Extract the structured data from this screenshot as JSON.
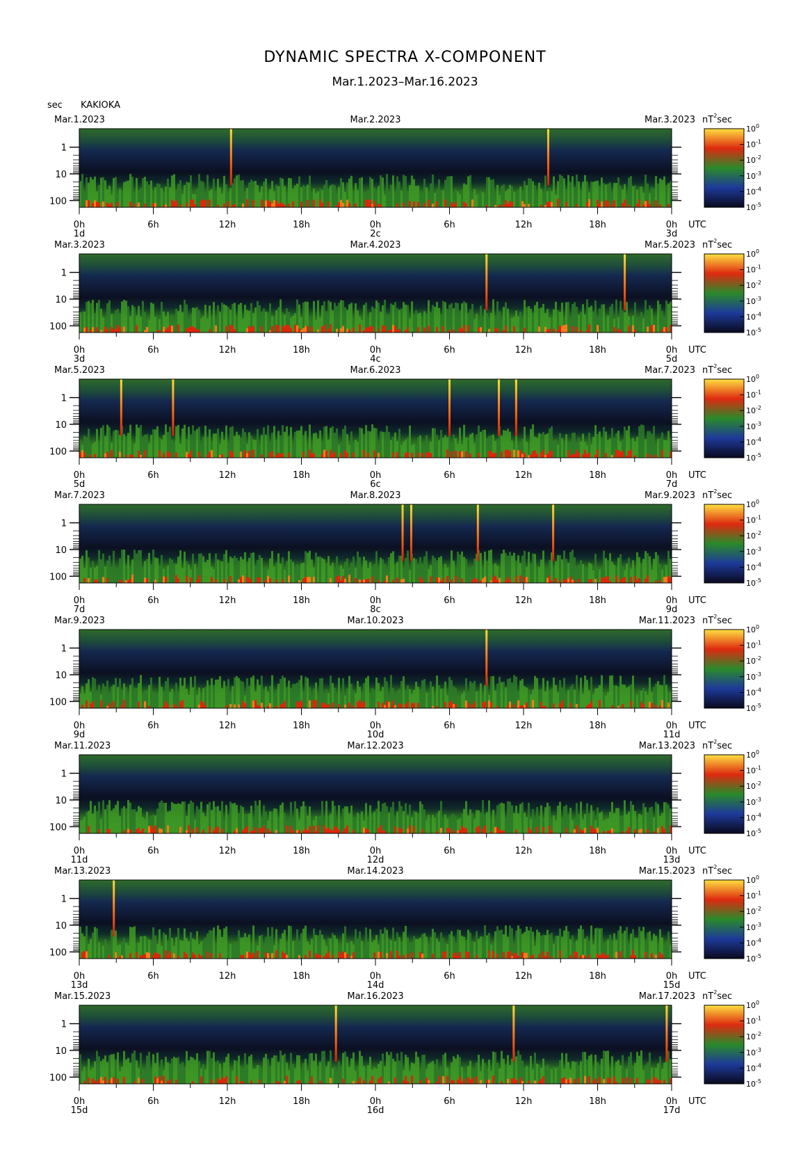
{
  "title": "DYNAMIC SPECTRA X-COMPONENT",
  "subtitle": "Mar.1.2023–Mar.16.2023",
  "header": {
    "unit_label": "sec",
    "station": "KAKIOKA"
  },
  "chart_data": {
    "type": "heatmap",
    "period_axis": {
      "label": "sec",
      "ticks": [
        "1",
        "10",
        "100"
      ],
      "scale": "log"
    },
    "time_axis": {
      "unit_label": "UTC",
      "hour_ticks": [
        "0h",
        "6h",
        "12h",
        "18h",
        "0h",
        "6h",
        "12h",
        "18h",
        "0h"
      ]
    },
    "colorbar": {
      "unit": "nT²sec",
      "scale": "log",
      "tick_exponents": [
        0,
        -1,
        -2,
        -3,
        -4,
        -5
      ],
      "colors": [
        "#0a0a1e",
        "#1d3a9a",
        "#2a8a2a",
        "#dd2a10",
        "#ffe040"
      ]
    },
    "panels": [
      {
        "left_date": "Mar.1.2023",
        "center_date": "Mar.2.2023",
        "right_date": "Mar.3.2023",
        "day_labels": [
          "1d",
          "2c",
          "3d"
        ],
        "spike_hours": [
          12.3,
          38.0
        ]
      },
      {
        "left_date": "Mar.3.2023",
        "center_date": "Mar.4.2023",
        "right_date": "Mar.5.2023",
        "day_labels": [
          "3d",
          "4c",
          "5d"
        ],
        "spike_hours": [
          33.0,
          44.2
        ]
      },
      {
        "left_date": "Mar.5.2023",
        "center_date": "Mar.6.2023",
        "right_date": "Mar.7.2023",
        "day_labels": [
          "5d",
          "6c",
          "7d"
        ],
        "spike_hours": [
          3.4,
          7.6,
          30.0,
          34.0,
          35.4
        ]
      },
      {
        "left_date": "Mar.7.2023",
        "center_date": "Mar.8.2023",
        "right_date": "Mar.9.2023",
        "day_labels": [
          "7d",
          "8c",
          "9d"
        ],
        "spike_hours": [
          26.2,
          26.9,
          32.3,
          38.4
        ]
      },
      {
        "left_date": "Mar.9.2023",
        "center_date": "Mar.10.2023",
        "right_date": "Mar.11.2023",
        "day_labels": [
          "9d",
          "10d",
          "11d"
        ],
        "spike_hours": [
          33.0
        ]
      },
      {
        "left_date": "Mar.11.2023",
        "center_date": "Mar.12.2023",
        "right_date": "Mar.13.2023",
        "day_labels": [
          "11d",
          "12d",
          "13d"
        ],
        "spike_hours": []
      },
      {
        "left_date": "Mar.13.2023",
        "center_date": "Mar.14.2023",
        "right_date": "Mar.15.2023",
        "day_labels": [
          "13d",
          "14d",
          "15d"
        ],
        "spike_hours": [
          2.8
        ]
      },
      {
        "left_date": "Mar.15.2023",
        "center_date": "Mar.16.2023",
        "right_date": "Mar.17.2023",
        "day_labels": [
          "15d",
          "16d",
          "17d"
        ],
        "spike_hours": [
          20.8,
          35.2,
          47.6
        ]
      }
    ]
  }
}
